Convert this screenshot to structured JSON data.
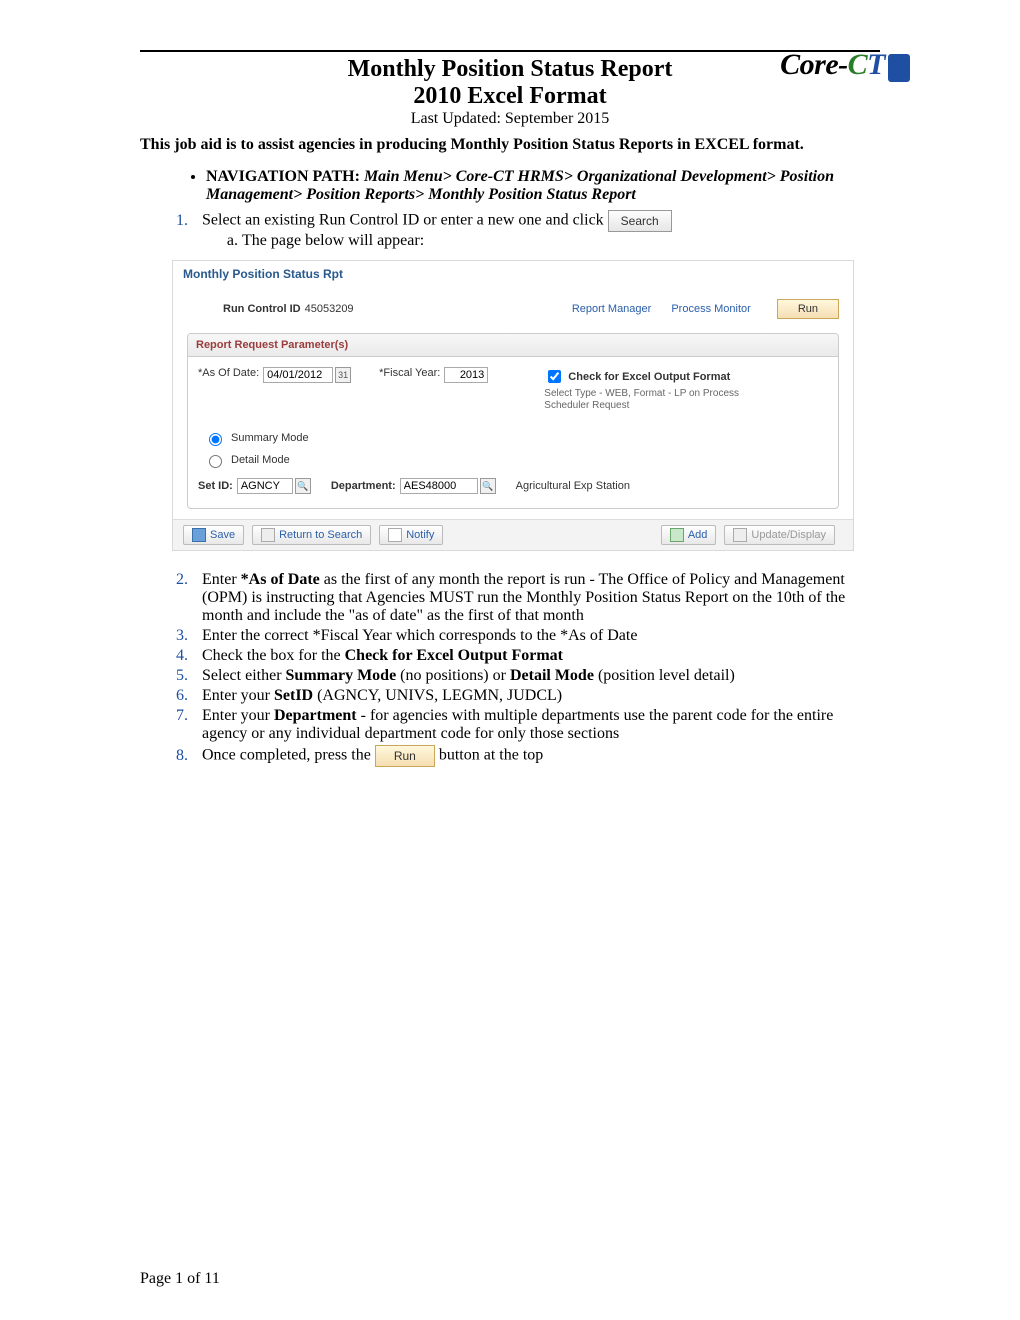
{
  "header": {
    "title": "Monthly Position Status Report",
    "subtitle": "2010 Excel Format",
    "updated": "Last Updated: September 2015",
    "logo_core": "Core-",
    "logo_c": "C",
    "logo_t": "T"
  },
  "intro": "This job aid is to assist agencies in producing Monthly Position Status Reports in EXCEL format.",
  "nav": {
    "label": "NAVIGATION PATH:  ",
    "path": "Main Menu> Core-CT HRMS> Organizational Development> Position Management> Position Reports> Monthly Position Status Report"
  },
  "step1": {
    "text_a": "Select an existing Run Control ID or enter a new one and click ",
    "search": "Search",
    "sub_a": "The page below will appear:"
  },
  "app": {
    "tab": "Monthly Position Status Rpt",
    "run_control_label": "Run Control ID",
    "run_control_value": "45053209",
    "report_manager": "Report Manager",
    "process_monitor": "Process Monitor",
    "run": "Run",
    "group_header": "Report Request Parameter(s)",
    "asof_label": "*As Of Date:",
    "asof_value": "04/01/2012",
    "fy_label": "*Fiscal Year:",
    "fy_value": "2013",
    "excel_label": "Check for Excel Output Format",
    "hint": "Select Type - WEB, Format - LP on Process Scheduler Request",
    "summary": "Summary Mode",
    "detail": "Detail Mode",
    "setid_label": "Set ID:",
    "setid_value": "AGNCY",
    "dept_label": "Department:",
    "dept_value": "AES48000",
    "dept_desc": "Agricultural Exp Station",
    "save": "Save",
    "return": "Return to Search",
    "notify": "Notify",
    "add": "Add",
    "update": "Update/Display"
  },
  "steps": {
    "s2_a": "Enter ",
    "s2_b": "*As of Date",
    "s2_c": " as the first of any month the report is run - The Office of Policy and Management (OPM) is instructing that Agencies MUST run the Monthly Position Status Report on the 10th of the month and include the \"as of date\" as the first of that month",
    "s3": "Enter the correct *Fiscal Year which corresponds to the *As of Date",
    "s4_a": "Check the box for the ",
    "s4_b": "Check for Excel Output Format",
    "s5_a": "Select either ",
    "s5_b": "Summary Mode",
    "s5_c": " (no positions) or ",
    "s5_d": "Detail Mode",
    "s5_e": " (position level detail)",
    "s6_a": "Enter your ",
    "s6_b": "SetID",
    "s6_c": " (AGNCY, UNIVS, LEGMN, JUDCL)",
    "s7_a": "Enter your ",
    "s7_b": "Department",
    "s7_c": " - for agencies with multiple departments use the parent code for the entire agency or any individual department code for only those sections",
    "s8_a": "Once completed, press the ",
    "s8_run": "Run",
    "s8_b": " button at the top"
  },
  "footer": "Page 1 of 11"
}
